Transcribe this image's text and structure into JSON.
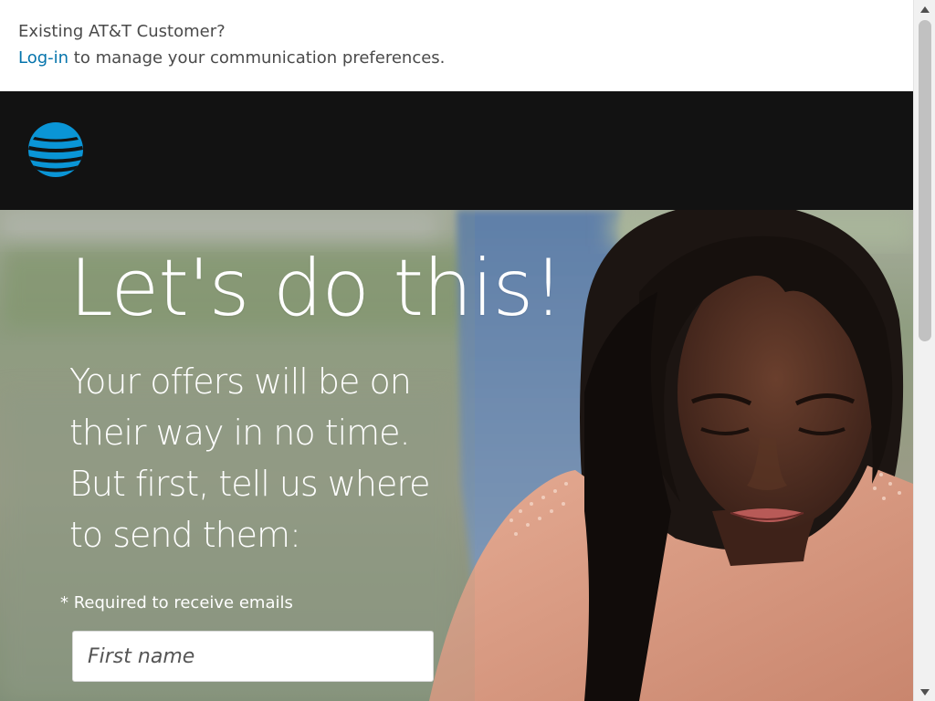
{
  "notice": {
    "question": "Existing AT&T Customer?",
    "login_link": "Log-in",
    "login_suffix": " to manage your communication preferences."
  },
  "brand": {
    "logo_icon": "att-globe-icon",
    "colors": {
      "header_bg": "#121212",
      "logo_blue": "#0a95d6",
      "link_blue": "#0574ac"
    }
  },
  "hero": {
    "headline": "Let's do this!",
    "subhead_lines": [
      "Your offers will be on",
      "their way in no time.",
      "But first, tell us where",
      "to send them:"
    ],
    "required_note": "* Required to receive emails"
  },
  "form": {
    "first_name_placeholder": "First name",
    "first_name_value": ""
  }
}
